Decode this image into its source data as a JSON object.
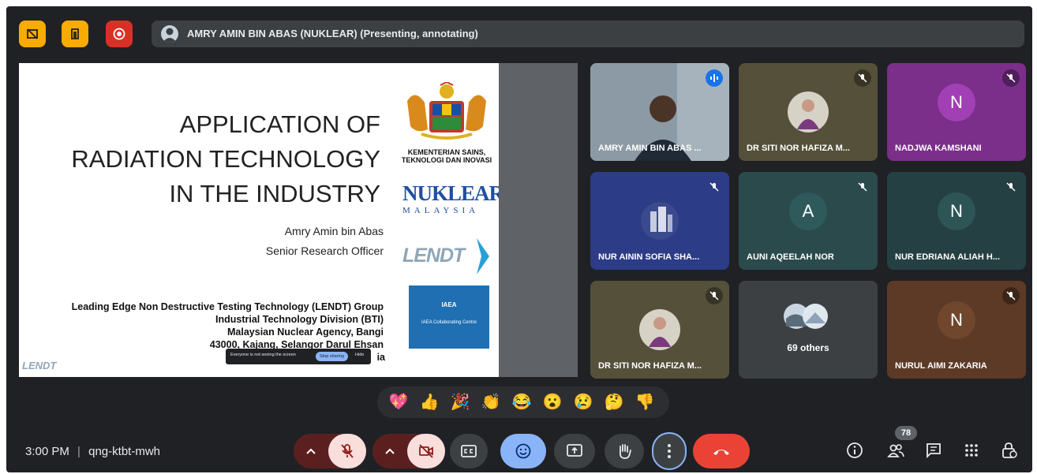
{
  "presenter_bar": {
    "text": "AMRY AMIN BIN ABAS (NUKLEAR) (Presenting, annotating)"
  },
  "slide": {
    "title_lines": [
      "APPLICATION OF",
      "RADIATION TECHNOLOGY",
      "IN THE INDUSTRY"
    ],
    "presenter_name": "Amry Amin bin Abas",
    "presenter_role": "Senior Research Officer",
    "group_lines": [
      "Leading Edge Non Destructive Testing Technology (LENDT) Group",
      "Industrial Technology Division (BTI)",
      "Malaysian Nuclear Agency, Bangi",
      "43000, Kajang, Selangor Darul Ehsan"
    ],
    "group_tail": "ia",
    "ministry_line1": "KEMENTERIAN SAINS,",
    "ministry_line2": "TEKNOLOGI DAN INOVASI",
    "nuklear_logo": "NUKLEAR",
    "nuklear_sub": "MALAYSIA",
    "lendt_logo": "LENDT",
    "iaea_label": "IAEA",
    "iaea_caption": "IAEA Collaborating Centre",
    "toast_text": "Everyone is not seeing the screen",
    "toast_button": "Stop sharing",
    "toast_dismiss": "Hide"
  },
  "tiles": [
    {
      "name": "AMRY AMIN BIN ABAS ...",
      "letter": "",
      "bg": "#7a8a96",
      "speaking": true
    },
    {
      "name": "DR SITI NOR HAFIZA M...",
      "letter": "",
      "bg": "#55503a",
      "muted": true
    },
    {
      "name": "NADJWA KAMSHANI",
      "letter": "N",
      "bg": "#7b2e8a",
      "avatar": "#a13fb5",
      "muted": true
    },
    {
      "name": "NUR AININ SOFIA SHA...",
      "letter": "",
      "bg": "#2c3c86",
      "muted": true
    },
    {
      "name": "AUNI AQEELAH NOR",
      "letter": "A",
      "bg": "#2b4a4c",
      "avatar": "#2f5a5c",
      "muted": true
    },
    {
      "name": "NUR EDRIANA ALIAH H...",
      "letter": "N",
      "bg": "#254042",
      "avatar": "#2e5556",
      "muted": true
    },
    {
      "name": "DR SITI NOR HAFIZA M...",
      "letter": "",
      "bg": "#55503a",
      "muted": true
    },
    {
      "name": "69 others",
      "letter": "",
      "bg": "#3c4043"
    },
    {
      "name": "NURUL AIMI ZAKARIA",
      "letter": "N",
      "bg": "#5c3a26",
      "avatar": "#70462d",
      "muted": true
    }
  ],
  "reactions": [
    "💖",
    "👍",
    "🎉",
    "👏",
    "😂",
    "😮",
    "😢",
    "🤔",
    "👎"
  ],
  "bottom": {
    "time": "3:00 PM",
    "separator": "|",
    "meeting_code": "qng-ktbt-mwh",
    "people_count": "78"
  },
  "colors": {
    "accent_yellow": "#f9ab00",
    "record_red": "#d93025",
    "end_call_red": "#ea4335",
    "active_blue": "#8ab4f8"
  }
}
